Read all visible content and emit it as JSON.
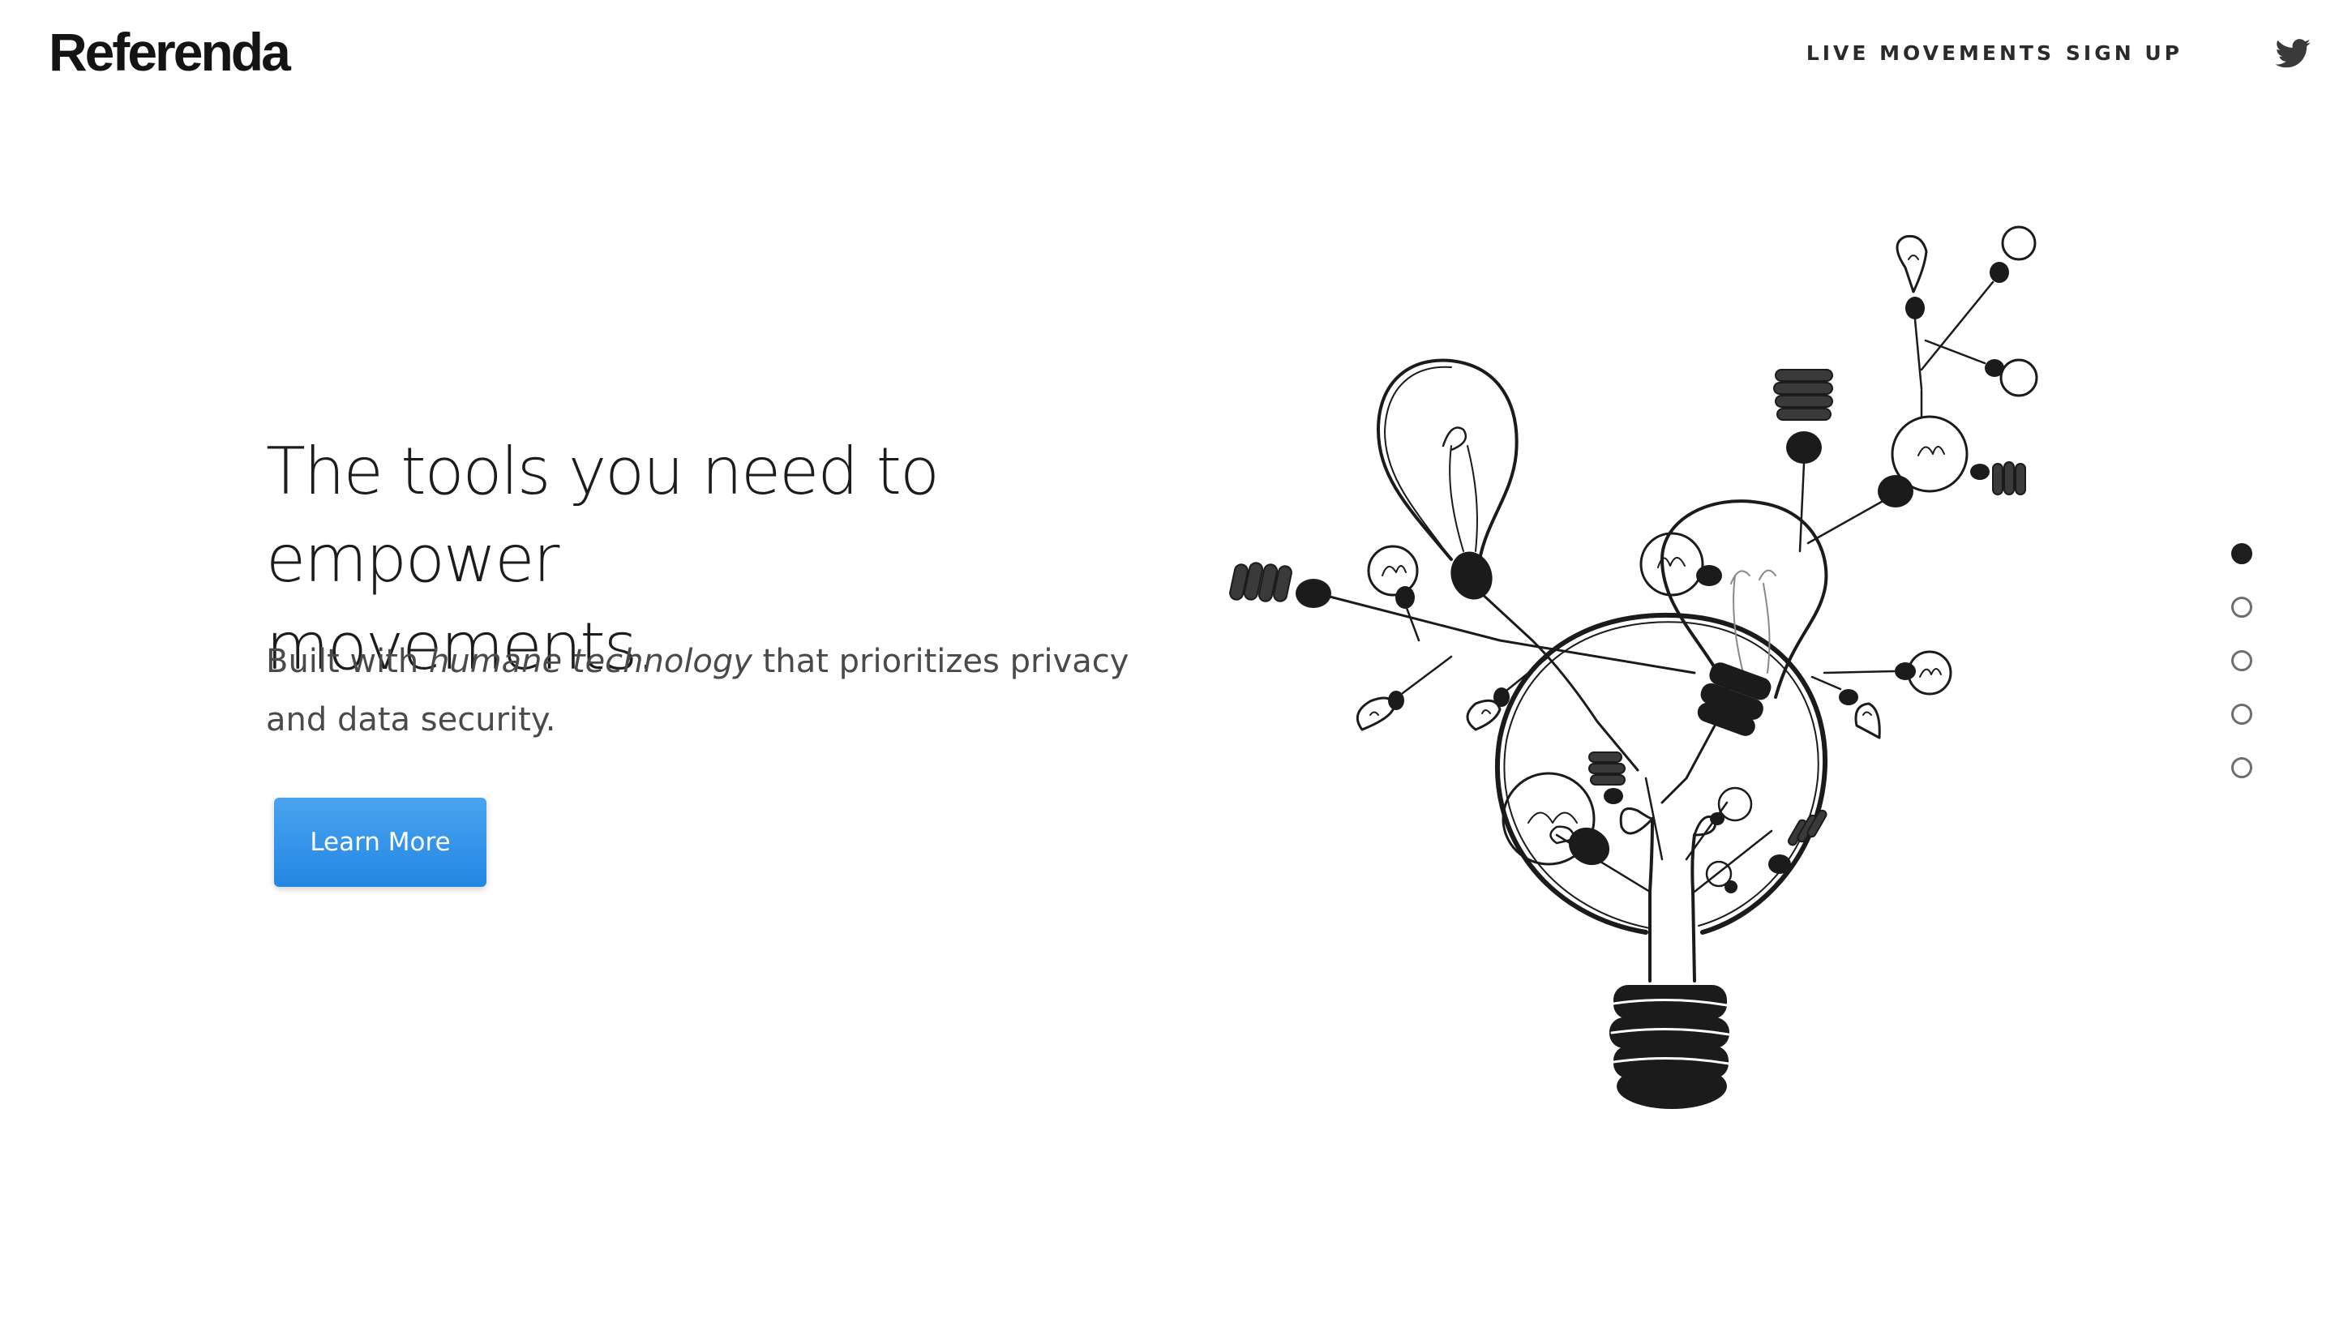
{
  "header": {
    "logo": "Referenda",
    "nav": [
      {
        "label": "LIVE MOVEMENTS"
      },
      {
        "label": "SIGN UP"
      }
    ],
    "social_icon": "twitter-icon"
  },
  "hero": {
    "headline_line1": "The tools you need to empower",
    "headline_line2": "movements.",
    "sub_prefix": "Built with ",
    "sub_emphasis": "humane technology",
    "sub_suffix": " that prioritizes privacy and data security.",
    "cta_label": "Learn More",
    "cta_color": "#2b8ee6",
    "illustration": "lightbulb-sketch-illustration"
  },
  "pager": {
    "count": 5,
    "active_index": 0
  }
}
